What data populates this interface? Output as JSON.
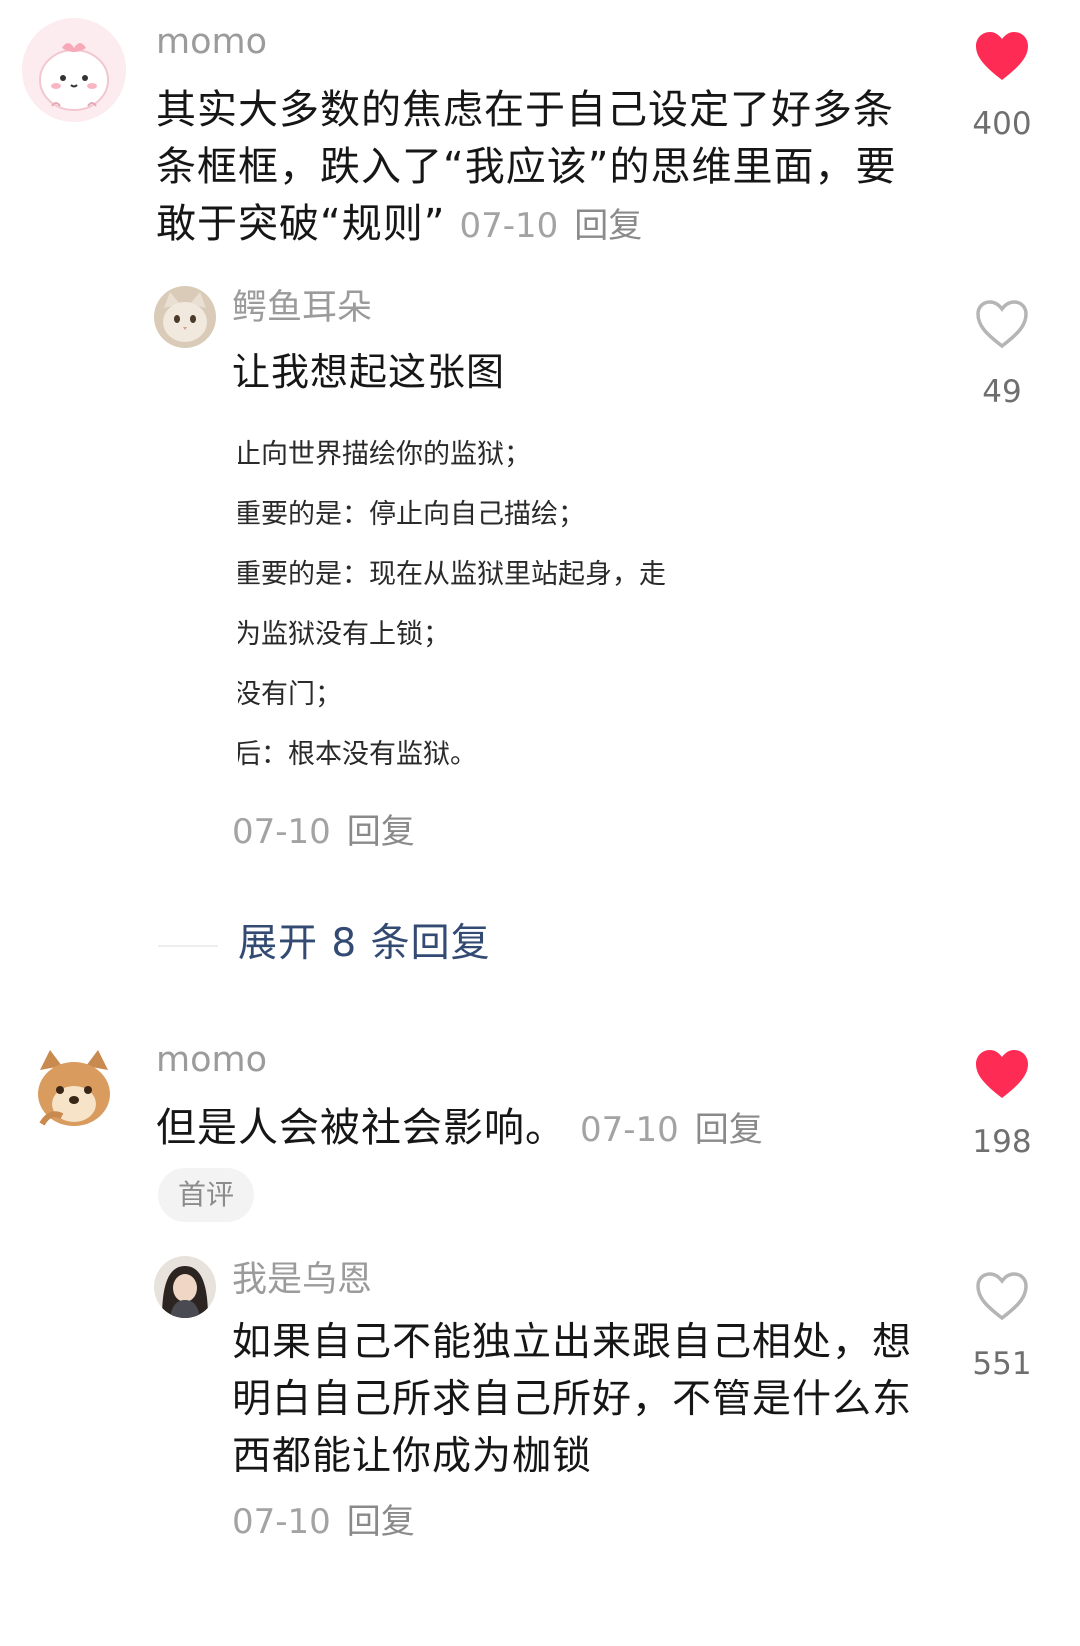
{
  "colors": {
    "like_active": "#fe2c55",
    "like_inactive": "#b5b5b5",
    "username": "#9b9b9b",
    "link": "#334a73"
  },
  "comments": [
    {
      "username": "momo",
      "avatar_icon": "pink-blob-avatar",
      "text": "其实大多数的焦虑在于自己设定了好多条条框框，跌入了“我应该”的思维里面，要敢于突破“规则”",
      "date": "07-10",
      "reply_label": "回复",
      "likes": "400",
      "liked": true
    },
    {
      "username": "momo",
      "avatar_icon": "chipmunk-avatar",
      "text": "但是人会被社会影响。",
      "date": "07-10",
      "reply_label": "回复",
      "likes": "198",
      "liked": true,
      "badge": "首评"
    }
  ],
  "replies": [
    {
      "username": "鳄鱼耳朵",
      "avatar_icon": "cat-avatar",
      "text": "让我想起这张图",
      "image_quote_lines": [
        "止向世界描绘你的监狱；",
        "重要的是：停止向自己描绘；",
        "重要的是：现在从监狱里站起身，走",
        "为监狱没有上锁；",
        "没有门；",
        "后：根本没有监狱。"
      ],
      "date": "07-10",
      "reply_label": "回复",
      "likes": "49",
      "liked": false
    },
    {
      "username": "我是乌恩",
      "avatar_icon": "girl-avatar",
      "text": "如果自己不能独立出来跟自己相处，想明白自己所求自己所好，不管是什么东西都能让你成为枷锁",
      "date": "07-10",
      "reply_label": "回复",
      "likes": "551",
      "liked": false
    }
  ],
  "expand_replies": "展开 8 条回复"
}
